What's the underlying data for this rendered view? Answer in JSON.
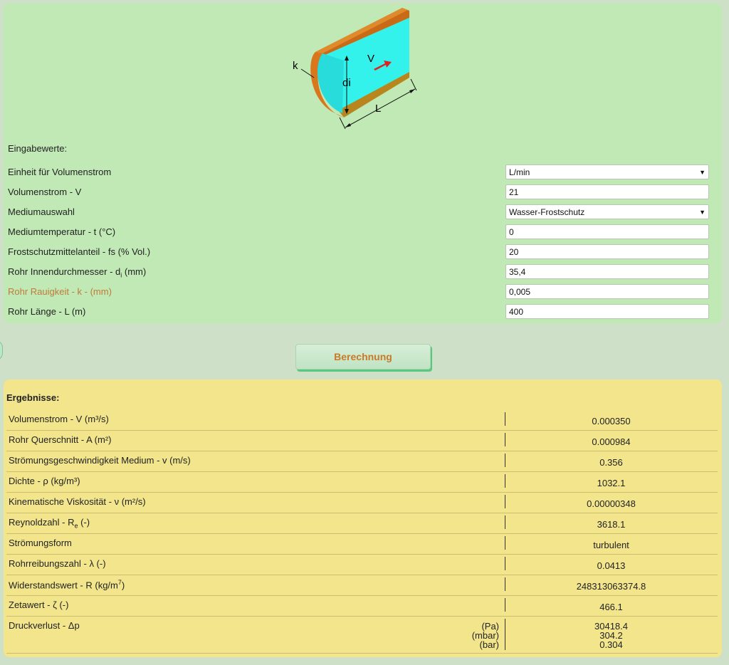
{
  "diagram": {
    "label_k": "k",
    "label_di": "di",
    "label_v": "V",
    "label_l": "L"
  },
  "inputs": {
    "title": "Eingabewerte:",
    "rows": [
      {
        "label": "Einheit für Volumenstrom",
        "type": "select",
        "value": "L/min"
      },
      {
        "label": "Volumenstrom - V",
        "type": "input",
        "value": "21"
      },
      {
        "label": "Mediumauswahl",
        "type": "select",
        "value": "Wasser-Frostschutz"
      },
      {
        "label": "Mediumtemperatur - t (°C)",
        "type": "input",
        "value": "0"
      },
      {
        "label": "Frostschutzmittelanteil - fs (% Vol.)",
        "type": "input",
        "value": "20"
      },
      {
        "label_pre": "Rohr Innendurchmesser - d",
        "label_sub": "i",
        "label_post": " (mm)",
        "type": "input",
        "value": "35,4"
      },
      {
        "label": "Rohr Rauigkeit - k - (mm)",
        "type": "input",
        "value": "0,005"
      },
      {
        "label": "Rohr Länge - L (m)",
        "type": "input",
        "value": "400"
      }
    ]
  },
  "button": {
    "label": "Berechnung"
  },
  "results": {
    "title": "Ergebnisse:",
    "rows": [
      {
        "label": "Volumenstrom - V (m³/s)",
        "value": "0.000350"
      },
      {
        "label": "Rohr Querschnitt - A (m²)",
        "value": "0.000984"
      },
      {
        "label": "Strömungsgeschwindigkeit Medium - v (m/s)",
        "value": "0.356"
      },
      {
        "label": "Dichte - ρ (kg/m³)",
        "value": "1032.1"
      },
      {
        "label": "Kinematische Viskosität - ν (m²/s)",
        "value": "0.00000348"
      },
      {
        "label_pre": "Reynoldzahl - R",
        "label_sub": "e",
        "label_post": " (-)",
        "value": "3618.1"
      },
      {
        "label": "Strömungsform",
        "value": "turbulent"
      },
      {
        "label": "Rohrreibungszahl - λ (-)",
        "value": "0.0413"
      },
      {
        "label_pre": "Widerstandswert - R (kg/m",
        "label_sup": "7",
        "label_post": ")",
        "value": "248313063374.8"
      },
      {
        "label": "Zetawert - ζ (-)",
        "value": "466.1"
      }
    ],
    "pressure": {
      "label": "Druckverlust - Δp",
      "units": [
        "(Pa)",
        "(mbar)",
        "(bar)"
      ],
      "values": [
        "30418.4",
        "304.2",
        "0.304"
      ]
    }
  },
  "colors": {
    "input_panel": "#c0e9b5",
    "results_panel": "#f2e58c",
    "accent": "#c97a28",
    "pipe_fluid": "#33f2ec",
    "pipe_wall": "#d9771c"
  }
}
